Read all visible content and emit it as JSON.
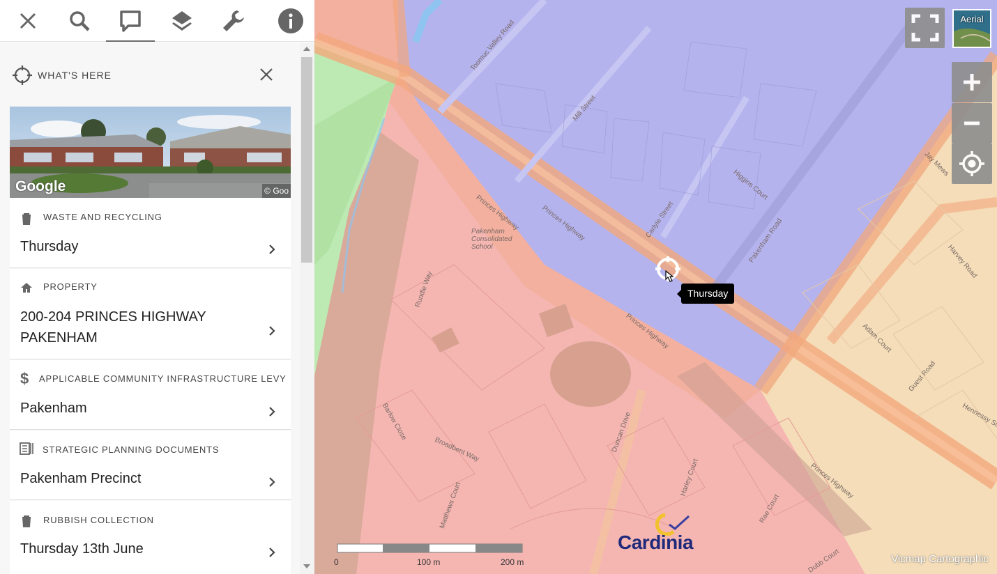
{
  "toolbar": {
    "items": [
      {
        "name": "close-tool-button",
        "icon": "close-icon"
      },
      {
        "name": "search-tool-button",
        "icon": "search-icon"
      },
      {
        "name": "whats-here-tool-button",
        "icon": "comment-icon",
        "active": true
      },
      {
        "name": "layers-tool-button",
        "icon": "layers-icon"
      },
      {
        "name": "tools-tool-button",
        "icon": "wrench-icon"
      },
      {
        "name": "info-tool-button",
        "icon": "info-icon"
      }
    ]
  },
  "whats_here": {
    "title": "WHAT'S HERE",
    "photo": {
      "watermark": "Google",
      "copyright": "© Goo"
    }
  },
  "cards": [
    {
      "icon": "trash-icon",
      "label": "WASTE AND RECYCLING",
      "value": "Thursday"
    },
    {
      "icon": "home-icon",
      "label": "PROPERTY",
      "value": "200-204 PRINCES HIGHWAY PAKENHAM"
    },
    {
      "icon": "dollar-icon",
      "label": "APPLICABLE COMMUNITY INFRASTRUCTURE LEVY",
      "value": "Pakenham"
    },
    {
      "icon": "document-list-icon",
      "label": "STRATEGIC PLANNING DOCUMENTS",
      "value": "Pakenham Precinct"
    },
    {
      "icon": "trash-icon",
      "label": "RUBBISH COLLECTION",
      "value": "Thursday 13th June"
    }
  ],
  "map": {
    "basemap_button": "Aerial",
    "tooltip": "Thursday",
    "attribution": "Vicmap Cartographic",
    "logo_text": "Cardinia",
    "scale": {
      "labels": [
        "0",
        "100 m",
        "200 m"
      ]
    },
    "street_labels": [
      "Toomuc Valley Road",
      "Mill Street",
      "Princes Highway",
      "Princes Highway",
      "Princes Highway",
      "Princes Highway",
      "Carlyle Street",
      "Pakenham Road",
      "Higgins Court",
      "Duncan Drive",
      "Pakenham Consolidated School",
      "Adam Court",
      "Harvey Road",
      "Guest Road",
      "Hennessy Street",
      "Rundle Way",
      "Barlow Close",
      "Broadbent Way",
      "Matthews Court",
      "Rae Court",
      "Dubb Court",
      "Harley Court",
      "Jay Mews"
    ],
    "colors": {
      "commercial": "#f5b6b2",
      "residential_high": "#b3b3ef",
      "residential": "#f4ddb8",
      "park": "#bde9b2",
      "road_major": "#f2a77c",
      "water": "#8ec4ef"
    }
  }
}
